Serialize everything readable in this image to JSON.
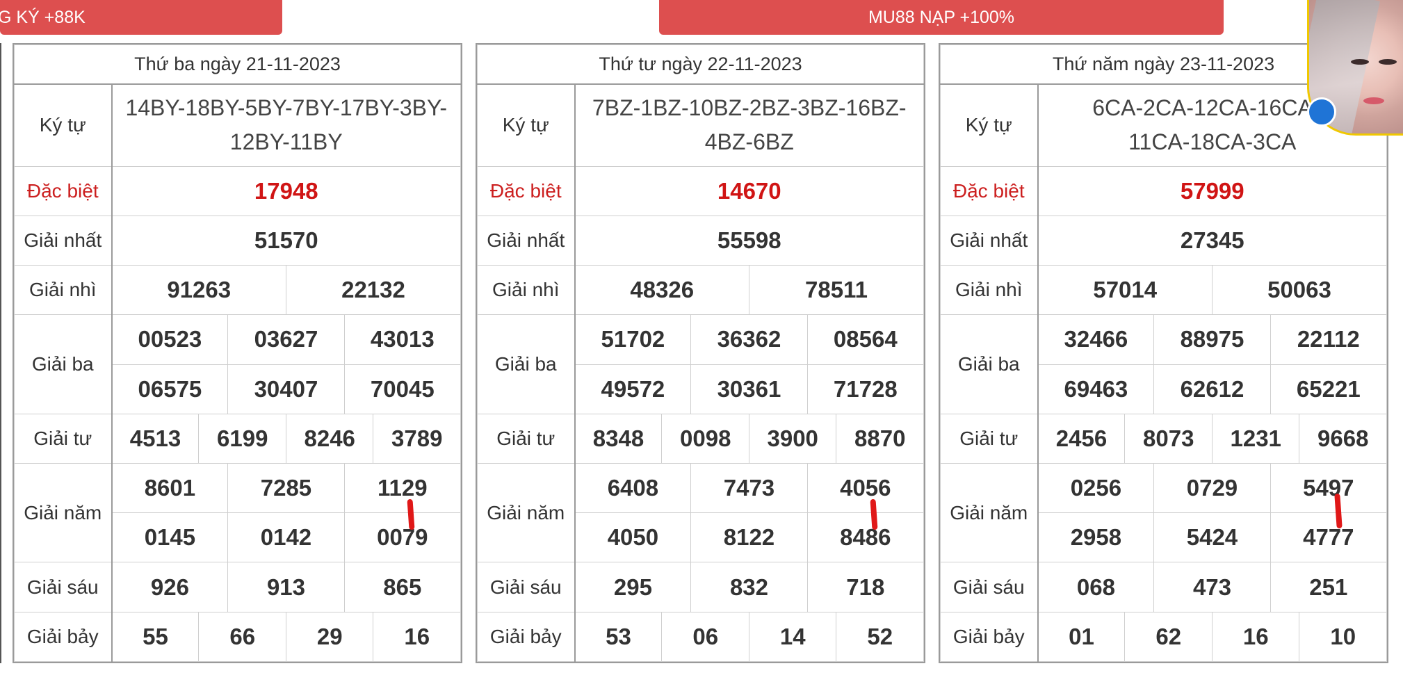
{
  "banners": {
    "left": "G KÝ +88K",
    "right": "MU88 NẠP +100%"
  },
  "labels": {
    "ky_tu": "Ký tự",
    "dac_biet": "Đặc biệt",
    "giai_nhat": "Giải nhất",
    "giai_nhi": "Giải nhì",
    "giai_ba": "Giải ba",
    "giai_tu": "Giải tư",
    "giai_nam": "Giải năm",
    "giai_sau": "Giải sáu",
    "giai_bay": "Giải bảy"
  },
  "results": [
    {
      "date": "Thứ ba ngày 21-11-2023",
      "code_line1": "14BY-18BY-5BY-7BY-17BY-3BY-",
      "code_line2": "12BY-11BY",
      "special": "17948",
      "first": "51570",
      "second": [
        "91263",
        "22132"
      ],
      "third": [
        "00523",
        "03627",
        "43013",
        "06575",
        "30407",
        "70045"
      ],
      "fourth": [
        "4513",
        "6199",
        "8246",
        "3789"
      ],
      "fifth": [
        "8601",
        "7285",
        "1129",
        "0145",
        "0142",
        "0079"
      ],
      "sixth": [
        "926",
        "913",
        "865"
      ],
      "seventh": [
        "55",
        "66",
        "29",
        "16"
      ]
    },
    {
      "date": "Thứ tư ngày 22-11-2023",
      "code_line1": "7BZ-1BZ-10BZ-2BZ-3BZ-16BZ-",
      "code_line2": "4BZ-6BZ",
      "special": "14670",
      "first": "55598",
      "second": [
        "48326",
        "78511"
      ],
      "third": [
        "51702",
        "36362",
        "08564",
        "49572",
        "30361",
        "71728"
      ],
      "fourth": [
        "8348",
        "0098",
        "3900",
        "8870"
      ],
      "fifth": [
        "6408",
        "7473",
        "4056",
        "4050",
        "8122",
        "8486"
      ],
      "sixth": [
        "295",
        "832",
        "718"
      ],
      "seventh": [
        "53",
        "06",
        "14",
        "52"
      ]
    },
    {
      "date": "Thứ năm ngày 23-11-2023",
      "code_line1": "6CA-2CA-12CA-16CA-8",
      "code_line2": "11CA-18CA-3CA",
      "special": "57999",
      "first": "27345",
      "second": [
        "57014",
        "50063"
      ],
      "third": [
        "32466",
        "88975",
        "22112",
        "69463",
        "62612",
        "65221"
      ],
      "fourth": [
        "2456",
        "8073",
        "1231",
        "9668"
      ],
      "fifth": [
        "0256",
        "0729",
        "5497",
        "2958",
        "5424",
        "4777"
      ],
      "sixth": [
        "068",
        "473",
        "251"
      ],
      "seventh": [
        "01",
        "62",
        "16",
        "10"
      ]
    }
  ]
}
